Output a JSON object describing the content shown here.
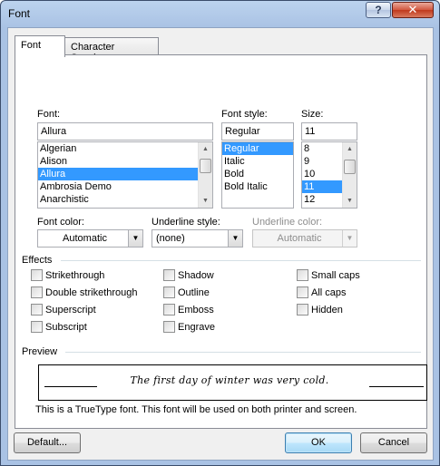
{
  "window": {
    "title": "Font",
    "help_label": "?",
    "close_label": "✕"
  },
  "tabs": [
    {
      "label": "Font",
      "active": true
    },
    {
      "label": "Character Spacing",
      "active": false
    }
  ],
  "font": {
    "label": "Font:",
    "value": "Allura",
    "items": [
      "Algerian",
      "Alison",
      "Allura",
      "Ambrosia Demo",
      "Anarchistic"
    ],
    "selected_index": 2
  },
  "font_style": {
    "label": "Font style:",
    "value": "Regular",
    "items": [
      "Regular",
      "Italic",
      "Bold",
      "Bold Italic"
    ],
    "selected_index": 0
  },
  "size": {
    "label": "Size:",
    "value": "11",
    "items": [
      "8",
      "9",
      "10",
      "11",
      "12"
    ],
    "selected_index": 3
  },
  "font_color": {
    "label": "Font color:",
    "value": "Automatic"
  },
  "underline_style": {
    "label": "Underline style:",
    "value": "(none)"
  },
  "underline_color": {
    "label": "Underline color:",
    "value": "Automatic"
  },
  "effects": {
    "label": "Effects",
    "col1": [
      {
        "label": "Strikethrough",
        "checked": false
      },
      {
        "label": "Double strikethrough",
        "checked": false
      },
      {
        "label": "Superscript",
        "checked": false
      },
      {
        "label": "Subscript",
        "checked": false
      }
    ],
    "col2": [
      {
        "label": "Shadow",
        "checked": false
      },
      {
        "label": "Outline",
        "checked": false
      },
      {
        "label": "Emboss",
        "checked": false
      },
      {
        "label": "Engrave",
        "checked": false
      }
    ],
    "col3": [
      {
        "label": "Small caps",
        "checked": false
      },
      {
        "label": "All caps",
        "checked": false
      },
      {
        "label": "Hidden",
        "checked": false
      }
    ]
  },
  "preview": {
    "label": "Preview",
    "sample": "The first day of winter was very cold.",
    "note": "This is a TrueType font. This font will be used on both printer and screen."
  },
  "buttons": {
    "default": "Default...",
    "ok": "OK",
    "cancel": "Cancel"
  },
  "icons": {
    "scroll_up": "up-arrow-icon",
    "scroll_down": "down-arrow-icon",
    "dropdown": "chevron-down-icon"
  }
}
